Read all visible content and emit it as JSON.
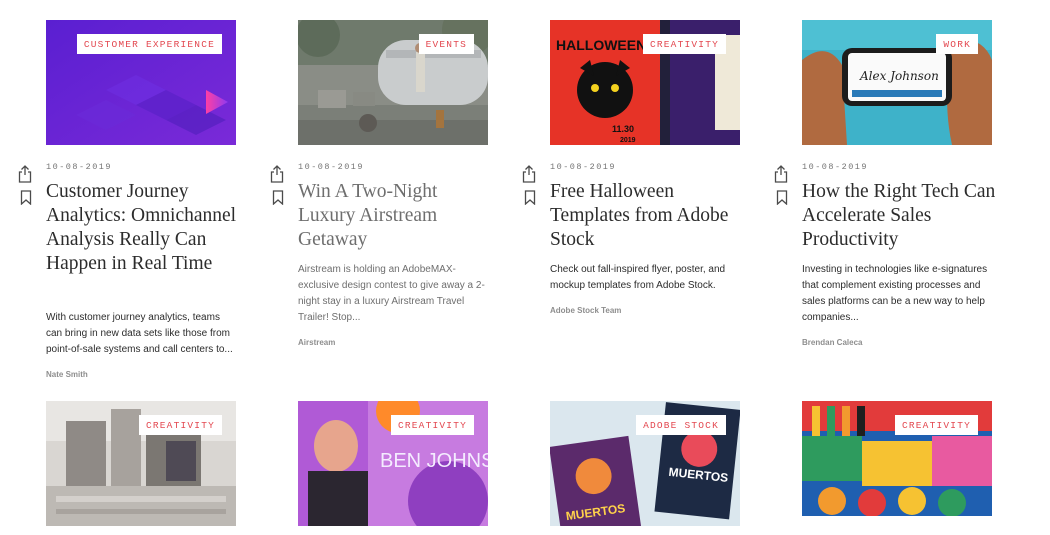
{
  "row1": [
    {
      "tag": "CUSTOMER EXPERIENCE",
      "date": "10-08-2019",
      "title": "Customer Journey Analytics: Omnichannel Analysis Really Can Happen in Real Time",
      "description": "With customer journey analytics, teams can bring in new data sets like those from point-of-sale systems and call centers to...",
      "author": "Nate Smith"
    },
    {
      "tag": "EVENTS",
      "date": "10-08-2019",
      "title": "Win A Two-Night Luxury Airstream Getaway",
      "description": "Airstream is holding an AdobeMAX-exclusive design contest to give away a 2-night stay in a luxury Airstream Travel Trailer! Stop...",
      "author": "Airstream"
    },
    {
      "tag": "CREATIVITY",
      "date": "10-08-2019",
      "title": "Free Halloween Templates from Adobe Stock",
      "description": "Check out fall-inspired flyer, poster, and mockup templates from Adobe Stock.",
      "author": "Adobe Stock Team",
      "image_text": [
        "HALLOWEEN",
        "11.30",
        "2019"
      ]
    },
    {
      "tag": "WORK",
      "date": "10-08-2019",
      "title": "How the Right Tech Can Accelerate Sales Productivity",
      "description": "Investing in technologies like e-signatures that complement existing processes and sales platforms can be a new way to help companies...",
      "author": "Brendan Caleca",
      "image_text": [
        "Alex Johnson"
      ]
    }
  ],
  "row2": [
    {
      "tag": "CREATIVITY"
    },
    {
      "tag": "CREATIVITY",
      "image_text": [
        "BEN JOHNSO"
      ]
    },
    {
      "tag": "ADOBE STOCK",
      "image_text": [
        "MUERTOS",
        "MUERTOS"
      ]
    },
    {
      "tag": "CREATIVITY"
    }
  ],
  "icons": {
    "share": "share-icon",
    "bookmark": "bookmark-icon"
  },
  "colors": {
    "tag_text": "#e34850",
    "title": "#2c2c2c",
    "muted_title": "#6e6e6e",
    "meta": "#747474"
  }
}
